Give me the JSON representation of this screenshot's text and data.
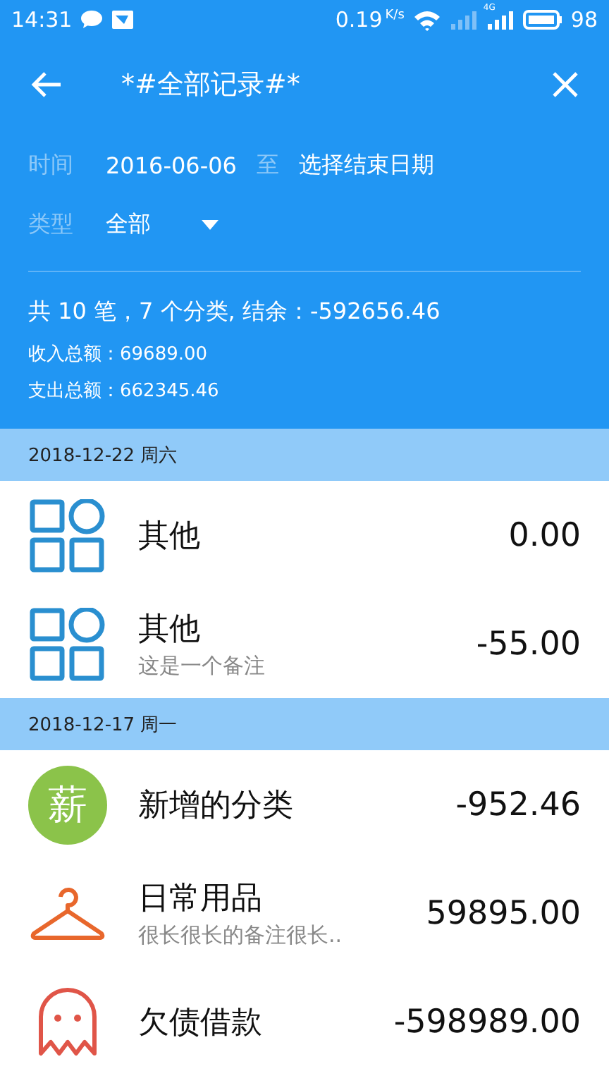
{
  "status_bar": {
    "time": "14:31",
    "speed": "0.19",
    "speed_unit": "K/s",
    "network": "4G",
    "battery": "98"
  },
  "app_bar": {
    "title": "*#全部记录#*"
  },
  "filters": {
    "time_label": "时间",
    "start_date": "2016-06-06",
    "to": "至",
    "end_placeholder": "选择结束日期",
    "type_label": "类型",
    "type_value": "全部"
  },
  "summary": {
    "headline": "共 10 笔，7 个分类, 结余：-592656.46",
    "income": "收入总额：69689.00",
    "expense": "支出总额：662345.46"
  },
  "groups": [
    {
      "date": "2018-12-22 周六",
      "records": [
        {
          "kind": "grid",
          "color": "#2a8fd0",
          "category": "其他",
          "amount": "0.00"
        },
        {
          "kind": "grid",
          "color": "#2a8fd0",
          "category": "其他",
          "note": "这是一个备注",
          "amount": "-55.00"
        }
      ]
    },
    {
      "date": "2018-12-17 周一",
      "records": [
        {
          "kind": "letter",
          "glyph": "薪",
          "color": "#8bc34a",
          "category": "新增的分类",
          "amount": "-952.46"
        },
        {
          "kind": "hanger",
          "color": "#e8672c",
          "category": "日常用品",
          "note": "很长很长的备注很长..",
          "amount": "59895.00"
        },
        {
          "kind": "ghost",
          "color": "#e05548",
          "category": "欠债借款",
          "amount": "-598989.00"
        }
      ]
    }
  ]
}
